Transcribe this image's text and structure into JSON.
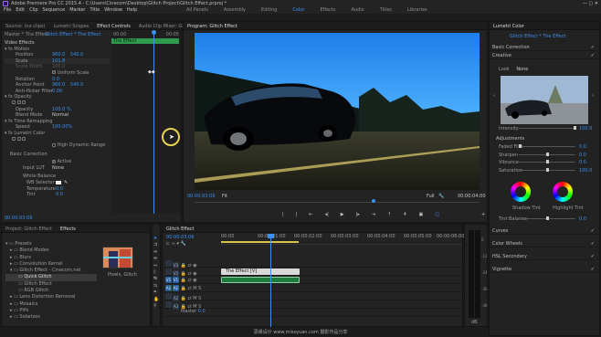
{
  "title": "Adobe Premiere Pro CC 2015.4 - C:\\Users\\Cinecom\\Desktop\\Glitch Project\\Glitch Effect.prproj *",
  "window_buttons": "—   ▢   ✕",
  "menu": [
    "File",
    "Edit",
    "Clip",
    "Sequence",
    "Marker",
    "Title",
    "Window",
    "Help"
  ],
  "workspaces": [
    "All Panels",
    "Assembly",
    "Editing",
    "Color",
    "Effects",
    "Audio",
    "Titles",
    "Libraries"
  ],
  "source_tabs": [
    "Source: (no clips)",
    "Lumetri Scopes",
    "Effect Controls",
    "Audio Clip Mixer: Glitch Effect"
  ],
  "effect_controls": {
    "clip_selector": "Glitch Effect * The Effect",
    "clip_bar_label": "The Effect",
    "time_label": "00:05",
    "section": "Video Effects",
    "motion": "Motion",
    "rows": [
      {
        "label": "Position",
        "value": "960.0",
        "value2": "540.0"
      },
      {
        "label": "Scale",
        "value": "101.8",
        "value2": ""
      },
      {
        "label": "Scale Width",
        "value": "100.0",
        "value2": ""
      },
      {
        "label": "Uniform Scale",
        "value": "",
        "value2": ""
      },
      {
        "label": "Rotation",
        "value": "0.0",
        "value2": ""
      },
      {
        "label": "Anchor Point",
        "value": "960.0",
        "value2": "540.0"
      },
      {
        "label": "Anti-flicker Filter",
        "value": "0.00",
        "value2": ""
      }
    ],
    "opacity": "Opacity",
    "opacity_value": "100.0 %",
    "blend_mode_label": "Blend Mode",
    "blend_mode": "Normal",
    "time_remap": "Time Remapping",
    "speed_label": "Speed",
    "speed_value": "100.00%",
    "lumetri": "Lumetri Color",
    "hdr": "High Dynamic Range",
    "basic_correction": "Basic Correction",
    "active": "Active",
    "input_lut_label": "Input LUT",
    "input_lut": "None",
    "white_balance": "White Balance",
    "wb_selector": "WB Selector",
    "temperature_label": "Temperature",
    "temperature_value": "0.0",
    "tint_label": "Tint",
    "tint_value": "0.0",
    "footer_time": "00:00:03:06"
  },
  "program": {
    "tab": "Program: Glitch Effect",
    "timecode": "00:00:03:06",
    "fit": "Fit",
    "quality": "Full",
    "duration": "00:00:04:00"
  },
  "lumetri_panel": {
    "tab": "Lumetri Color",
    "clip_selector": "Glitch Effect * The Effect",
    "basic_correction": "Basic Correction",
    "creative": "Creative",
    "look_label": "Look",
    "look_value": "None",
    "intensity_label": "Intensity",
    "intensity_value": "100.0",
    "adjustments": "Adjustments",
    "sliders": [
      {
        "label": "Faded Film",
        "value": "0.0"
      },
      {
        "label": "Sharpen",
        "value": "0.0"
      },
      {
        "label": "Vibrance",
        "value": "0.0"
      },
      {
        "label": "Saturation",
        "value": "100.0"
      }
    ],
    "shadow_tint": "Shadow Tint",
    "highlight_tint": "Highlight Tint",
    "tint_balance_label": "Tint Balance",
    "tint_balance_value": "0.0",
    "sections": [
      "Curves",
      "Color Wheels",
      "HSL Secondary",
      "Vignette"
    ]
  },
  "project": {
    "tabs": [
      "Project: Glitch Effect",
      "Effects"
    ],
    "tree": [
      "Presets",
      "Blend Modes",
      "Blurs",
      "Convolution Kernel",
      "Glitch Effect - Cinecom.net",
      "Quick Glitch",
      "Glitch Effect",
      "RGB Glitch",
      "Lens Distortion Removal",
      "Mosaics",
      "PiPs",
      "Solarizes"
    ],
    "preview_label": "Pixels, Glitch"
  },
  "timeline": {
    "tab": "Glitch Effect",
    "timecode": "00:00:03:06",
    "ruler": [
      "00:00",
      "00:00:01:00",
      "00:00:02:00",
      "00:00:03:00",
      "00:00:04:00",
      "00:00:05:00",
      "00:00:06:00"
    ],
    "video_tracks": [
      "V3",
      "V2",
      "V1"
    ],
    "audio_tracks": [
      "A1",
      "A2",
      "A3"
    ],
    "master": "Master",
    "master_value": "0.0",
    "clip_label": "The Effect [V]"
  },
  "meter": {
    "labels": [
      "0",
      "-12",
      "-24",
      "-36",
      "-48",
      "dB"
    ]
  },
  "watermark": "思缘设计 www.missyuan.com  摄影作品分享",
  "colors": {
    "accent": "#3b8ff0",
    "clip_green": "#1f7a3e",
    "clip_white": "#d8d8d8",
    "cursor_ring": "#e6d34f"
  }
}
